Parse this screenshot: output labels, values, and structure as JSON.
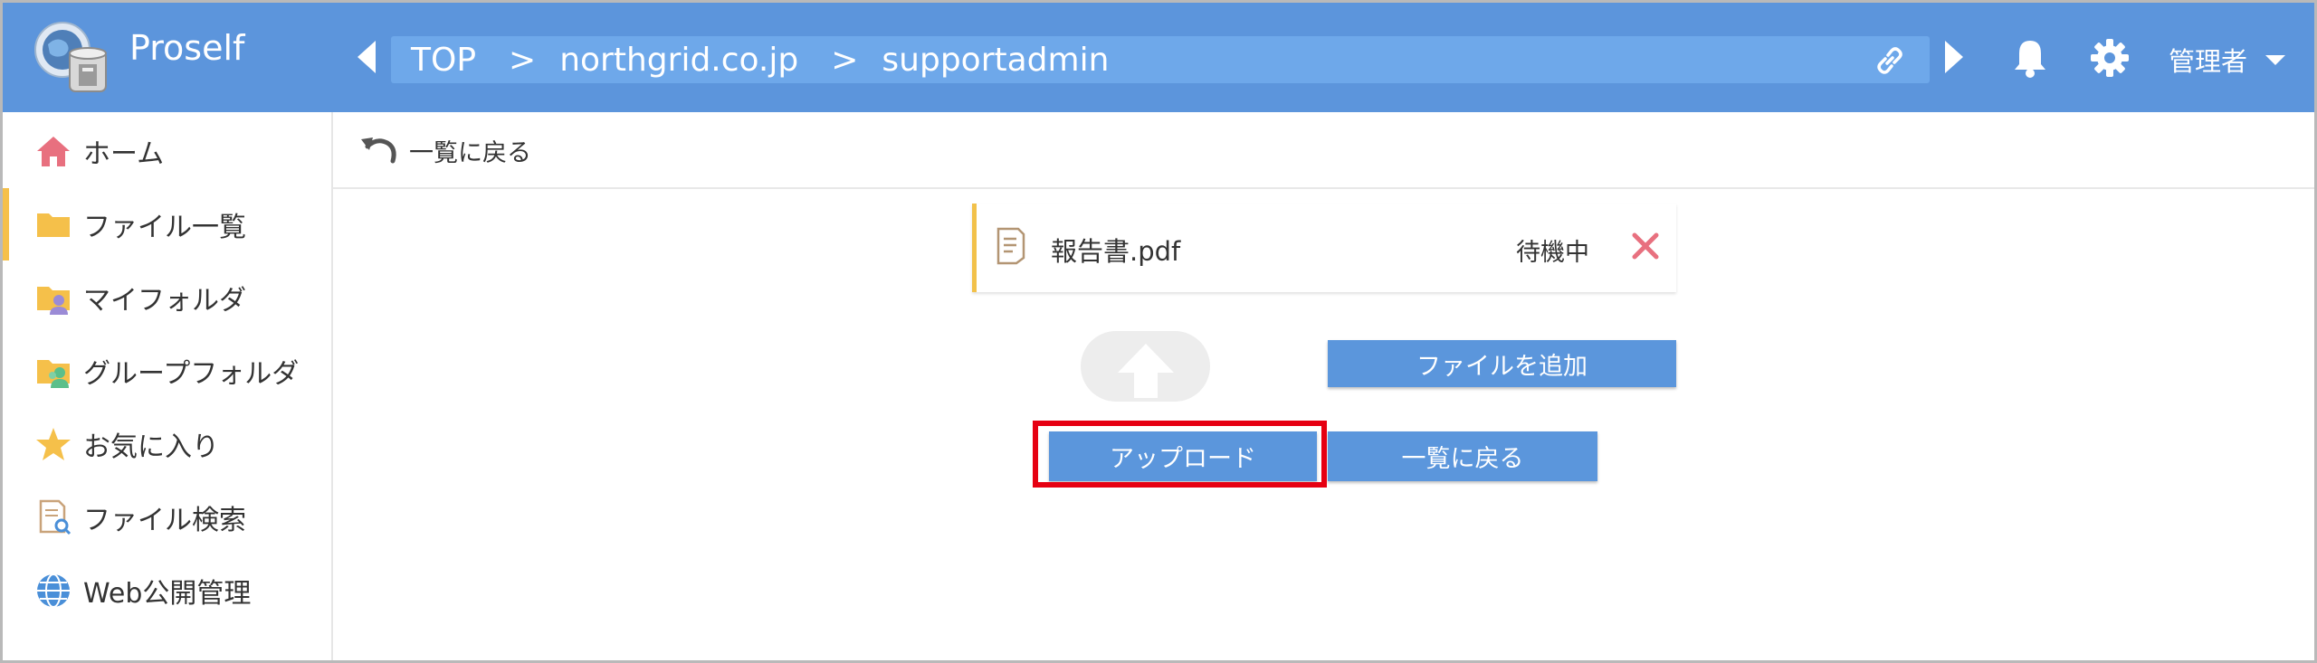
{
  "header": {
    "app_name": "Proself",
    "breadcrumb": [
      "TOP",
      "northgrid.co.jp",
      "supportadmin"
    ],
    "breadcrumb_separator": ">",
    "user_label": "管理者"
  },
  "sidebar": {
    "items": [
      {
        "label": "ホーム",
        "icon": "home-icon"
      },
      {
        "label": "ファイル一覧",
        "icon": "folder-icon"
      },
      {
        "label": "マイフォルダ",
        "icon": "my-folder-icon"
      },
      {
        "label": "グループフォルダ",
        "icon": "group-folder-icon"
      },
      {
        "label": "お気に入り",
        "icon": "star-icon"
      },
      {
        "label": "ファイル検索",
        "icon": "file-search-icon"
      },
      {
        "label": "Web公開管理",
        "icon": "globe-icon"
      }
    ]
  },
  "toolbar": {
    "back_label": "一覧に戻る"
  },
  "upload": {
    "file_name": "報告書.pdf",
    "file_status": "待機中",
    "add_file_label": "ファイルを追加",
    "upload_label": "アップロード",
    "back_label": "一覧に戻る"
  },
  "colors": {
    "header": "#5c95dc",
    "breadcrumb_bg": "#6ea8ea",
    "button": "#5b96dc",
    "active_marker": "#f5c04a",
    "highlight": "#e60012",
    "remove": "#e8707f"
  }
}
